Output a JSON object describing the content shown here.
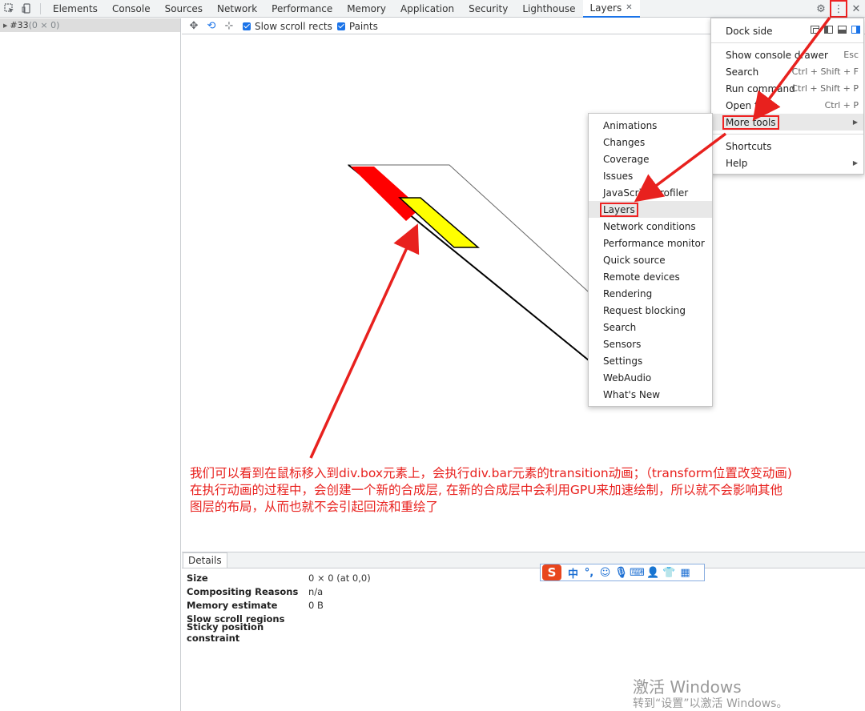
{
  "tabs": [
    {
      "label": "Elements"
    },
    {
      "label": "Console"
    },
    {
      "label": "Sources"
    },
    {
      "label": "Network"
    },
    {
      "label": "Performance"
    },
    {
      "label": "Memory"
    },
    {
      "label": "Application"
    },
    {
      "label": "Security"
    },
    {
      "label": "Lighthouse"
    },
    {
      "label": "Layers",
      "active": true,
      "close": "✕"
    }
  ],
  "tree": {
    "node": "#33",
    "size": "(0 × 0)"
  },
  "toolbar": {
    "slow_scroll": "Slow scroll rects",
    "paints": "Paints"
  },
  "annotation": [
    "我们可以看到在鼠标移入到div.box元素上，会执行div.bar元素的transition动画；（transform位置改变动画)",
    "在执行动画的过程中，会创建一个新的合成层, 在新的合成层中会利用GPU来加速绘制，所以就不会影响其他",
    "图层的布局，从而也就不会引起回流和重绘了"
  ],
  "details": {
    "tab": "Details",
    "rows": [
      {
        "label": "Size",
        "value": "0 × 0 (at 0,0)"
      },
      {
        "label": "Compositing Reasons",
        "value": "n/a"
      },
      {
        "label": "Memory estimate",
        "value": "0 B"
      },
      {
        "label": "Slow scroll regions",
        "value": ""
      },
      {
        "label": "Sticky position constraint",
        "value": ""
      }
    ]
  },
  "main_menu": {
    "dock_side": "Dock side",
    "items": [
      {
        "label": "Show console drawer",
        "shortcut": "Esc"
      },
      {
        "label": "Search",
        "shortcut": "Ctrl + Shift + F"
      },
      {
        "label": "Run command",
        "shortcut": "Ctrl + Shift + P"
      },
      {
        "label": "Open file",
        "shortcut": "Ctrl + P"
      }
    ],
    "more_tools": "More tools",
    "shortcuts": "Shortcuts",
    "help": "Help"
  },
  "more_tools_menu": [
    "Animations",
    "Changes",
    "Coverage",
    "Issues",
    "JavaScript Profiler",
    "Layers",
    "Network conditions",
    "Performance monitor",
    "Quick source",
    "Remote devices",
    "Rendering",
    "Request blocking",
    "Search",
    "Sensors",
    "Settings",
    "WebAudio",
    "What's New"
  ],
  "ime": {
    "logo": "S",
    "mode": "中",
    "punct": "°,"
  },
  "watermark": {
    "line1": "激活 Windows",
    "line2": "转到“设置”以激活 Windows。"
  },
  "colors": {
    "annotation": "#e8211e",
    "accent": "#1a73e8",
    "red_layer": "#ff0000",
    "yellow_layer": "#ffff00"
  }
}
